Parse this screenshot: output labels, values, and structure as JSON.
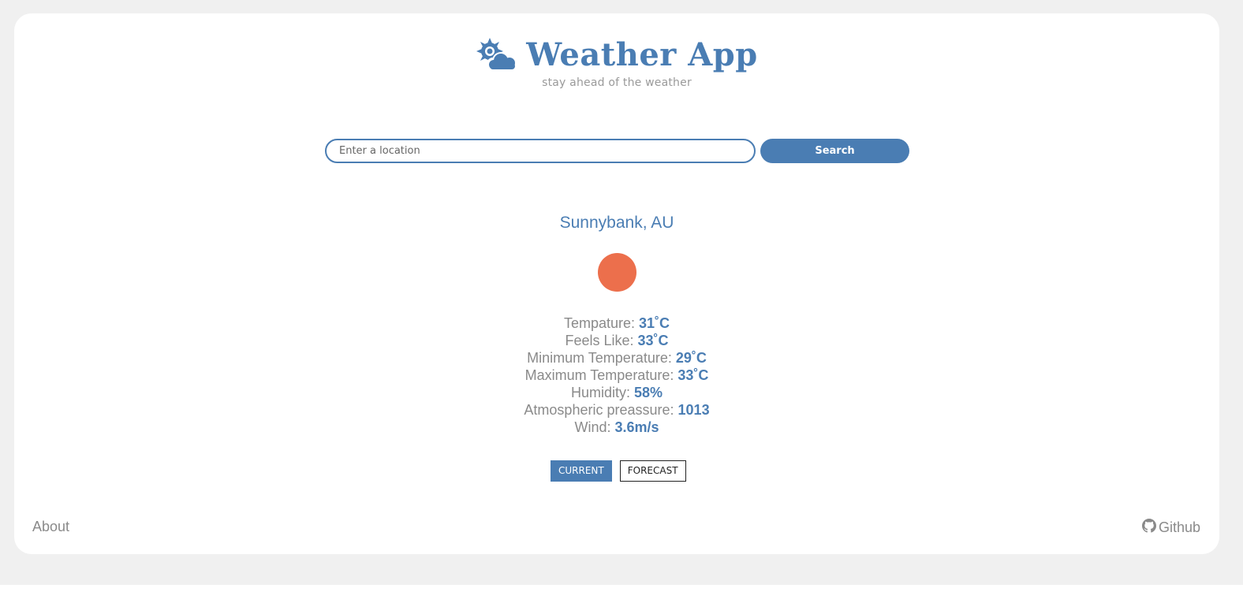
{
  "header": {
    "title": "Weather App",
    "tagline": "stay ahead of the weather",
    "logo_icon": "sun-cloud-icon"
  },
  "search": {
    "placeholder": "Enter a location",
    "value": "",
    "button_label": "Search"
  },
  "weather": {
    "location": "Sunnybank, AU",
    "icon": "sun-icon",
    "icon_color": "#ec6f4c",
    "details": [
      {
        "label": "Tempature:",
        "value": "31˚C"
      },
      {
        "label": "Feels Like:",
        "value": "33˚C"
      },
      {
        "label": "Minimum Temperature:",
        "value": "29˚C"
      },
      {
        "label": "Maximum Temperature:",
        "value": "33˚C"
      },
      {
        "label": "Humidity:",
        "value": "58%"
      },
      {
        "label": "Atmospheric preassure:",
        "value": "1013"
      },
      {
        "label": "Wind:",
        "value": "3.6m/s"
      }
    ]
  },
  "tabs": [
    {
      "label": "CURRENT",
      "active": true
    },
    {
      "label": "FORECAST",
      "active": false
    }
  ],
  "footer": {
    "about_label": "About",
    "github_label": "Github",
    "github_icon": "github-icon"
  },
  "colors": {
    "accent": "#4a7db3",
    "muted_text": "#8a8a8a",
    "page_background": "#f0f0f0"
  }
}
